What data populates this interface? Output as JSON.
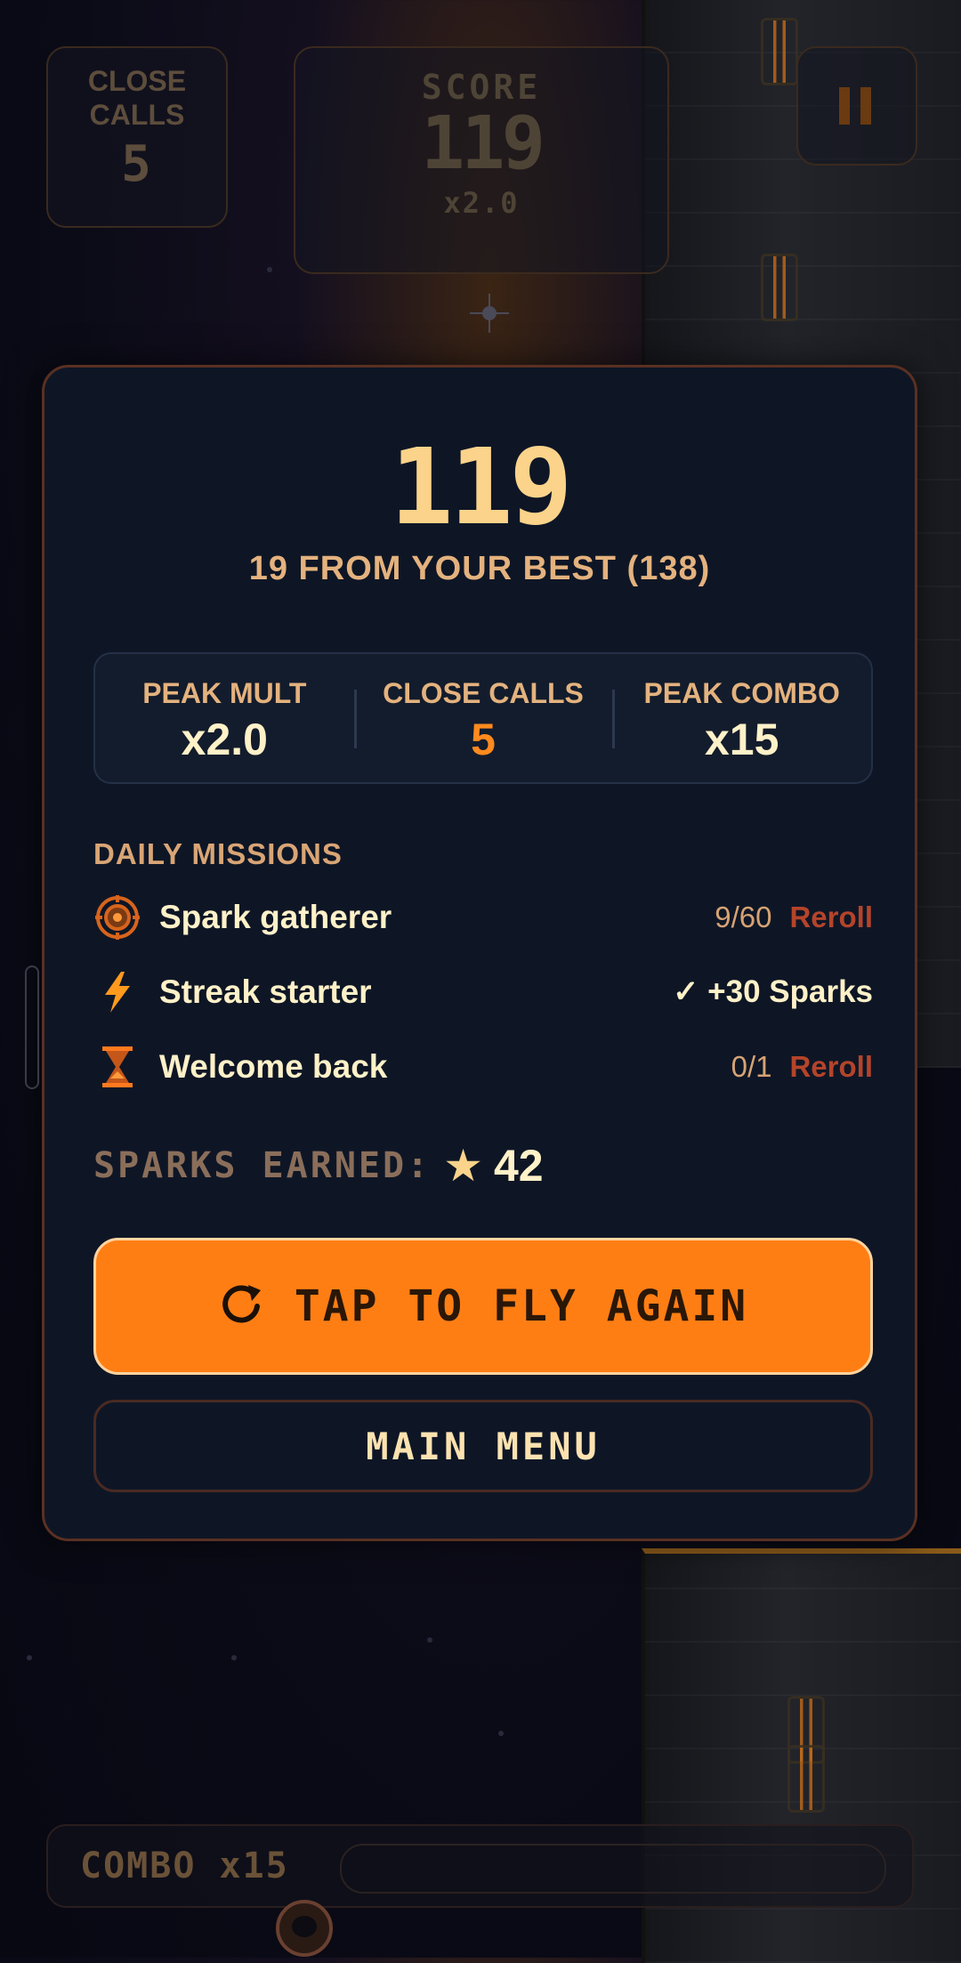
{
  "hud": {
    "close_calls_label_1": "CLOSE",
    "close_calls_label_2": "CALLS",
    "close_calls_value": "5",
    "score_label": "SCORE",
    "score_value": "119",
    "score_multiplier": "x2.0",
    "pause_icon": "pause-icon"
  },
  "game_over": {
    "final_score": "119",
    "best_note": "19 FROM YOUR BEST (138)",
    "stats": [
      {
        "label": "PEAK MULT",
        "value": "x2.0"
      },
      {
        "label": "CLOSE CALLS",
        "value": "5"
      },
      {
        "label": "PEAK COMBO",
        "value": "x15"
      }
    ],
    "missions_title": "DAILY MISSIONS",
    "missions": [
      {
        "icon": "target-icon",
        "name": "Spark gatherer",
        "progress": "9/60",
        "action": "Reroll"
      },
      {
        "icon": "lightning-icon",
        "name": "Streak starter",
        "reward": "✓ +30 Sparks"
      },
      {
        "icon": "hourglass-icon",
        "name": "Welcome back",
        "progress": "0/1",
        "action": "Reroll"
      }
    ],
    "sparks_label": "SPARKS EARNED:",
    "sparks_value": "42",
    "fly_again_label": "TAP TO FLY AGAIN",
    "main_menu_label": "MAIN MENU"
  },
  "combo": {
    "label": "COMBO",
    "value": "x15"
  },
  "colors": {
    "accent_orange": "#ff7e14",
    "text_cream": "#fff1c8",
    "label_tan": "#e4b27e",
    "reroll_red": "#b4442a",
    "panel_bg": "#0e1626"
  }
}
